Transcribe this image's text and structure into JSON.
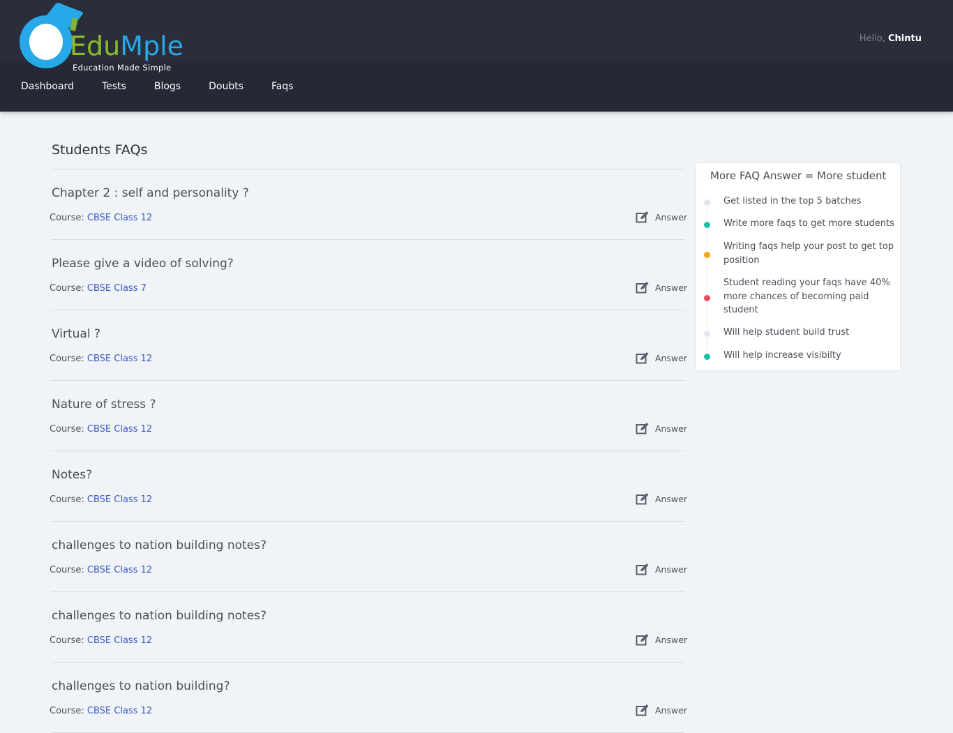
{
  "brand": {
    "name_part1": "Edu",
    "name_part2": "Mple",
    "tagline": "Education Made Simple"
  },
  "header": {
    "greeting": "Hello,",
    "user": "Chintu"
  },
  "nav": [
    "Dashboard",
    "Tests",
    "Blogs",
    "Doubts",
    "Faqs"
  ],
  "main": {
    "title": "Students FAQs",
    "course_label": "Course:",
    "answer_label": "Answer",
    "faqs": [
      {
        "question": "Chapter 2 : self and personality ?",
        "course": "CBSE Class 12"
      },
      {
        "question": "Please give a video of solving?",
        "course": "CBSE Class 7"
      },
      {
        "question": "Virtual ?",
        "course": "CBSE Class 12"
      },
      {
        "question": "Nature of stress ?",
        "course": "CBSE Class 12"
      },
      {
        "question": "Notes?",
        "course": "CBSE Class 12"
      },
      {
        "question": "challenges to nation building notes?",
        "course": "CBSE Class 12"
      },
      {
        "question": "challenges to nation building notes?",
        "course": "CBSE Class 12"
      },
      {
        "question": "challenges to nation building?",
        "course": "CBSE Class 12"
      }
    ]
  },
  "sidebar": {
    "title": "More FAQ Answer = More student",
    "items": [
      {
        "text": "Get listed in the top 5 batches",
        "color": "#e4e5ee"
      },
      {
        "text": "Write more faqs to get more students",
        "color": "#1bbfa9"
      },
      {
        "text": "Writing faqs help your post to get top position",
        "color": "#f7a416"
      },
      {
        "text": "Student reading your faqs have 40% more chances of becoming paid student",
        "color": "#ef4a5e"
      },
      {
        "text": "Will help student build trust",
        "color": "#e4e5ee"
      },
      {
        "text": "Will help increase visibilty",
        "color": "#1bbfa9"
      }
    ]
  }
}
